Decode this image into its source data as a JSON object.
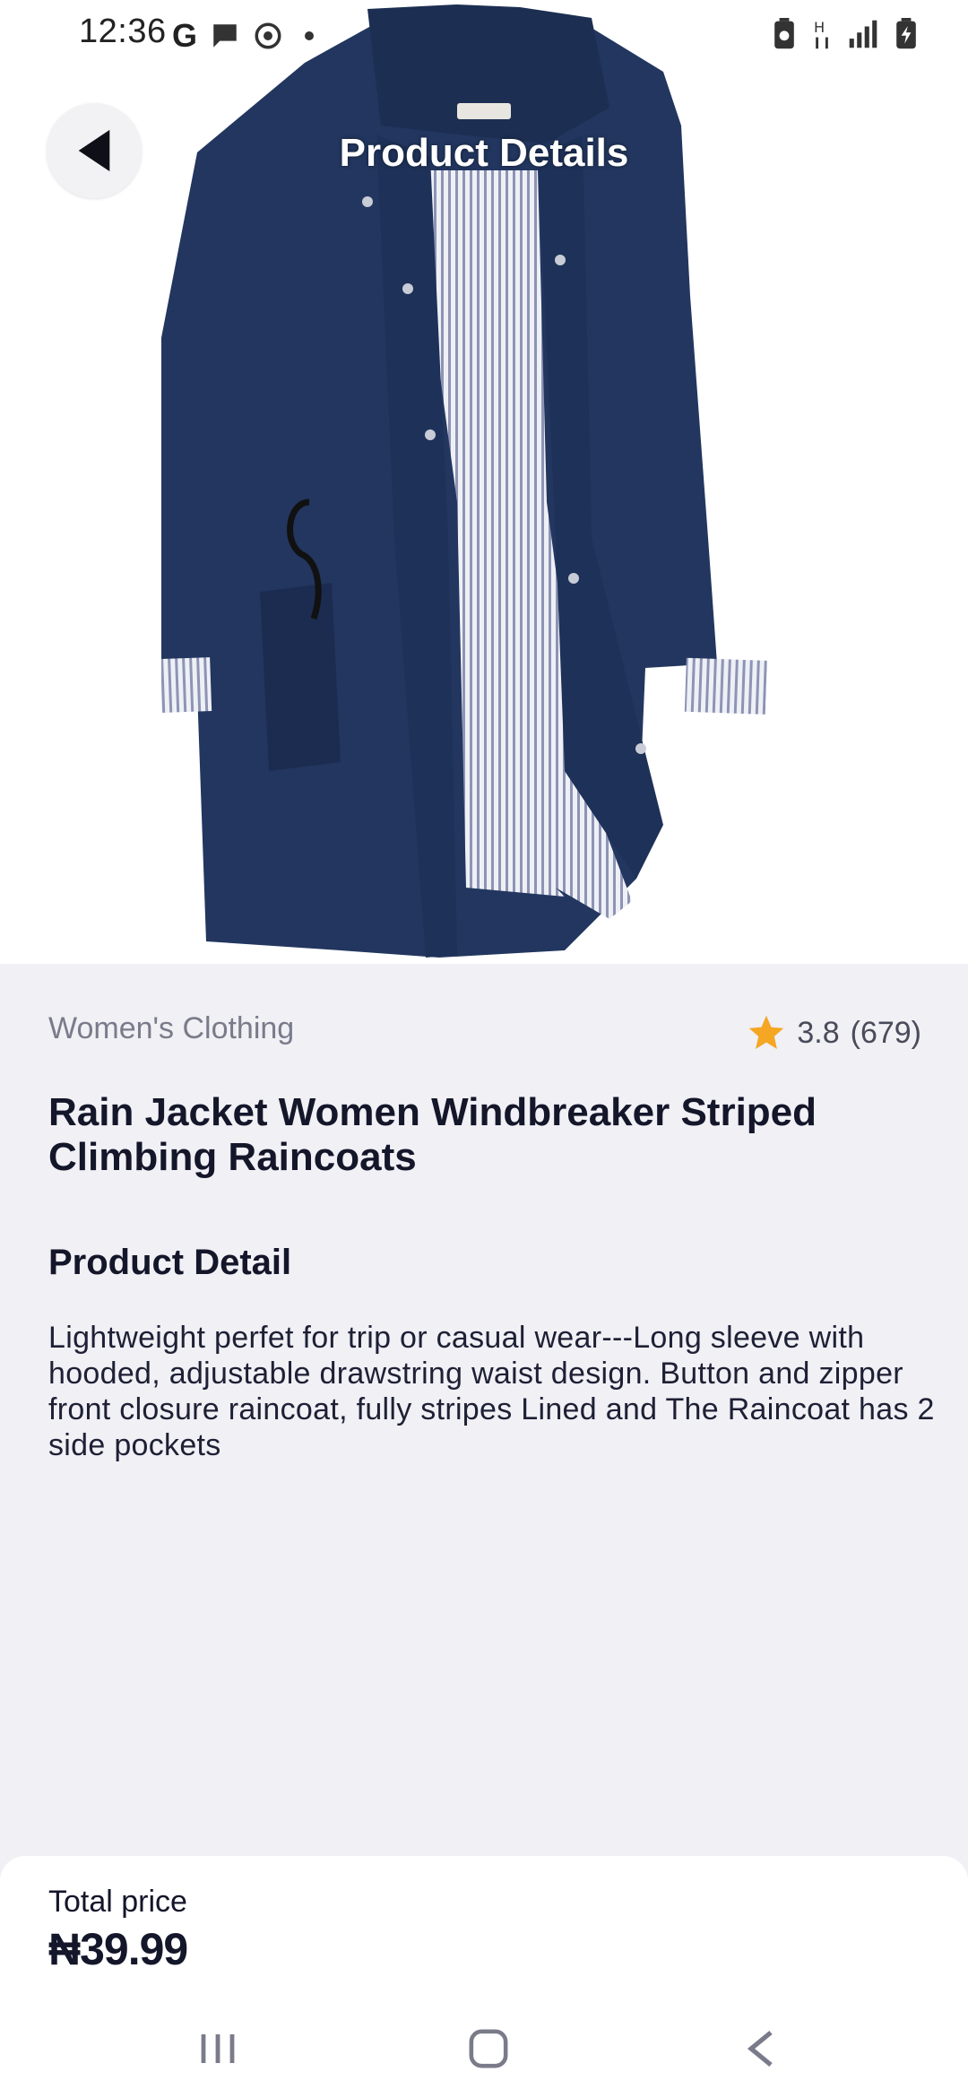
{
  "status_bar": {
    "time": "12:36",
    "left_icons": [
      "google-icon",
      "message-icon",
      "sync-icon",
      "notification-dot-icon"
    ],
    "right_icons": [
      "battery-saver-icon",
      "network-h-icon",
      "signal-icon",
      "battery-charging-icon"
    ]
  },
  "header": {
    "title": "Product Details",
    "back_icon": "back-arrow-icon"
  },
  "product": {
    "image": "navy-rain-jacket-image",
    "category": "Women's Clothing",
    "rating": "3.8",
    "reviews": "(679)",
    "name": "Rain Jacket Women Windbreaker Striped Climbing Raincoats",
    "detail_heading": "Product Detail",
    "description": "Lightweight perfet for trip or casual wear---Long sleeve with hooded, adjustable drawstring waist design. Button and zipper front closure raincoat, fully stripes Lined and The Raincoat has 2 side pockets"
  },
  "footer": {
    "price_label": "Total price",
    "price": "₦39.99"
  },
  "nav_bar": {
    "items": [
      "recents-icon",
      "home-icon",
      "back-icon"
    ]
  },
  "colors": {
    "background": "#f0f0f5",
    "text": "#14162a",
    "muted": "#7a7b8a",
    "star": "#f5a623",
    "jacket": "#22365f"
  }
}
